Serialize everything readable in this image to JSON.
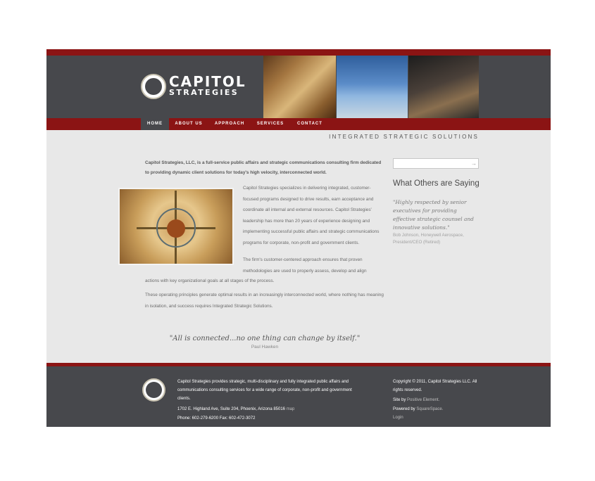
{
  "brand": {
    "name_line1": "CAPITOL",
    "name_line2": "STRATEGIES"
  },
  "header": {
    "photos": [
      "document-photo",
      "capitol-photo",
      "microphones-photo"
    ]
  },
  "nav": {
    "items": [
      {
        "label": "HOME"
      },
      {
        "label": "ABOUT US"
      },
      {
        "label": "APPROACH"
      },
      {
        "label": "SERVICES"
      },
      {
        "label": "CONTACT"
      }
    ]
  },
  "tagline": "INTEGRATED STRATEGIC SOLUTIONS",
  "main": {
    "intro": "Capitol Strategies, LLC, is a full-service public affairs and strategic communications consulting firm dedicated to providing dynamic client solutions for today's high velocity, interconnected world.",
    "para1": "Capitol Strategies specializes in delivering integrated, customer-focused programs designed to drive results, earn acceptance and coordinate all internal and external resources. Capitol Strategies' leadership has more than 20 years of experience designing and implementing successful public affairs and strategic communications programs for corporate, non-profit and government clients.",
    "para2_head": "The firm's customer-centered approach ensures that proven methodologies are used to properly assess, develop and align",
    "para2_tail": "actions with key organizational goals at all stages of the process.",
    "para3": "These operating principles generate optimal results in an increasingly interconnected world, where nothing has meaning in isolation, and success requires Integrated Strategic Solutions.",
    "quote": "\"All is connected...no one thing can change by itself.\"",
    "quote_author": "Paul Hawken"
  },
  "sidebar": {
    "search_button": "→",
    "title": "What Others are Saying",
    "testimonial": "\"Highly respected by senior executives for providing effective strategic counsel and innovative solutions.\"",
    "testimonial_author": "Bob Johnson, Honeywell Aerospace, President/CEO (Retired)"
  },
  "footer": {
    "about": "Capitol Strategies provides strategic, multi-disciplinary and fully integrated public affairs and communications consulting services for a wide range of corporate, non-profit and government clients.",
    "address": "1702 E. Highland Ave, Suite 204, Phoenix, Arizona 85016",
    "map_link": "map",
    "phone": "Phone: 602-279-6200 Fax: 602-472-3072",
    "copyright": "Copyright © 2011, Capitol Strategies LLC. All rights reserved.",
    "site_by_prefix": "Site by",
    "site_by_link": "Positive Element.",
    "powered_prefix": "Powered by",
    "powered_link": "SquareSpace.",
    "login": "Login"
  },
  "colors": {
    "accent_red": "#8b1414",
    "header_gray": "#47484c",
    "page_bg": "#e8e8e8"
  }
}
